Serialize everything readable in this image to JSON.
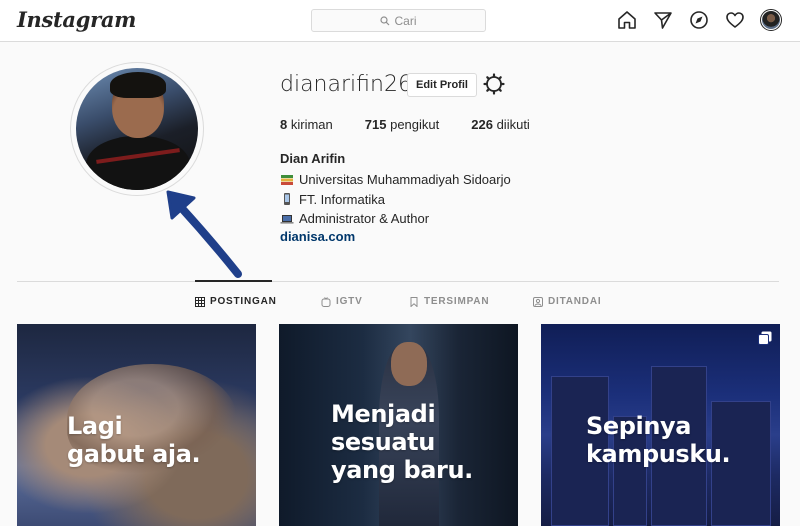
{
  "topbar": {
    "logo": "Instagram",
    "search_placeholder": "Cari"
  },
  "profile": {
    "username": "dianarifin26",
    "edit_label": "Edit Profil",
    "stats": [
      {
        "value": "8",
        "label": "kiriman"
      },
      {
        "value": "715",
        "label": "pengikut"
      },
      {
        "value": "226",
        "label": "diikuti"
      }
    ],
    "full_name": "Dian Arifin",
    "bio": [
      {
        "icon": "books-emoji",
        "text": "Universitas Muhammadiyah Sidoarjo"
      },
      {
        "icon": "phone-emoji",
        "text": "FT. Informatika"
      },
      {
        "icon": "laptop-emoji",
        "text": "Administrator & Author"
      }
    ],
    "website": "dianisa.com"
  },
  "tabs": [
    {
      "label": "POSTINGAN",
      "icon": "grid-icon",
      "active": true
    },
    {
      "label": "IGTV",
      "icon": "igtv-icon",
      "active": false
    },
    {
      "label": "TERSIMPAN",
      "icon": "bookmark-icon",
      "active": false
    },
    {
      "label": "DITANDAI",
      "icon": "tagged-icon",
      "active": false
    }
  ],
  "posts": [
    {
      "caption_lines": [
        "Lagi",
        "gabut aja."
      ]
    },
    {
      "caption_lines": [
        "Menjadi",
        "sesuatu",
        "yang baru."
      ]
    },
    {
      "caption_lines": [
        "Sepinya",
        "kampusku."
      ],
      "multiple": true
    }
  ],
  "colors": {
    "link": "#00376b",
    "border": "#dbdbdb",
    "annotation_arrow": "#1f3f8a"
  }
}
